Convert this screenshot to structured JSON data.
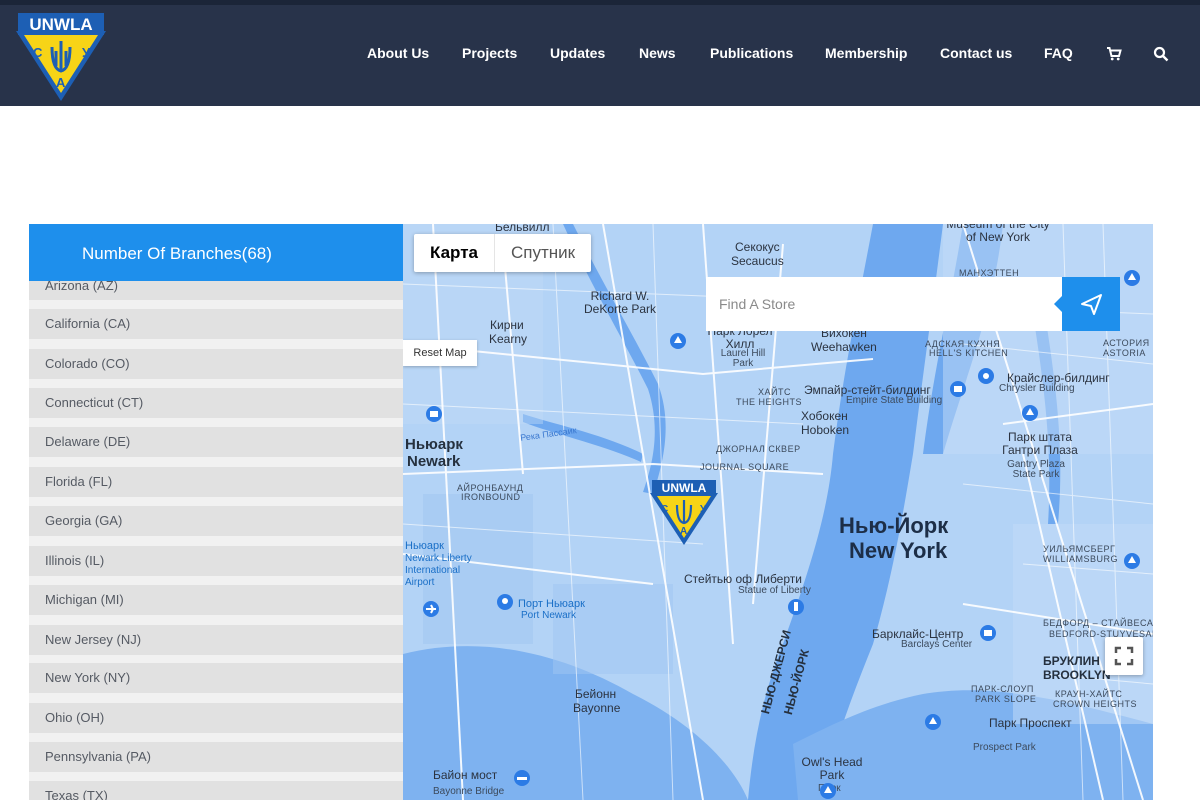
{
  "brand": {
    "logo_text": "UNWLA",
    "logo_letters": [
      "С",
      "У",
      "А"
    ],
    "colors": {
      "header_bg": "#28334a",
      "accent": "#1e8fec",
      "logo_blue": "#1d5fb4",
      "logo_yellow": "#f7d417"
    }
  },
  "nav": {
    "items": [
      "About Us",
      "Projects",
      "Updates",
      "News",
      "Publications",
      "Membership",
      "Contact us",
      "FAQ"
    ],
    "icons": [
      "cart-icon",
      "search-icon"
    ]
  },
  "sidebar": {
    "title": "Number Of Branches(68)",
    "states": [
      "Arizona (AZ)",
      "California (CA)",
      "Colorado (CO)",
      "Connecticut (CT)",
      "Delaware (DE)",
      "Florida (FL)",
      "Georgia (GA)",
      "Illinois (IL)",
      "Michigan (MI)",
      "New Jersey (NJ)",
      "New York (NY)",
      "Ohio (OH)",
      "Pennsylvania (PA)",
      "Texas (TX)"
    ]
  },
  "map": {
    "type_options": {
      "active": "Карта",
      "inactive": "Спутник"
    },
    "reset_label": "Reset Map",
    "search_placeholder": "Find A Store",
    "labels": {
      "ny_ru": "Нью-Йорк",
      "ny_en": "New York",
      "newark_ru": "Ньюарк",
      "newark_en": "Newark",
      "hoboken_ru": "Хобокен",
      "hoboken_en": "Hoboken",
      "secaucus_ru": "Секокус",
      "secaucus_en": "Secaucus",
      "kearny_ru": "Кирни",
      "kearny_en": "Kearny",
      "weehawken_ru": "Вихокен",
      "weehawken_en": "Weehawken",
      "bayonne_ru": "Бейонн",
      "bayonne_en": "Bayonne",
      "manhattan": "МАНХЭТТЕН",
      "heights": "ХАЙТС",
      "the_heights": "THE HEIGHTS",
      "journal_ru": "ДЖОРНАЛ СКВЕР",
      "journal_en": "JOURNAL SQUARE",
      "ironbound_ru": "АЙРОНБАУНД",
      "ironbound_en": "IRONBOUND",
      "hells_ru": "АДСКАЯ КУХНЯ",
      "hells_en": "HELL'S KITCHEN",
      "williamsburg_ru": "УИЛЬЯМСБЕРГ",
      "williamsburg_en": "WILLIAMSBURG",
      "brooklyn_ru": "БРУКЛИН",
      "brooklyn_en": "BROOKLYN",
      "empire_ru": "Эмпайр-стейт-билдинг",
      "empire_en": "Empire State Building",
      "chrysler_ru": "Крайслер-билдинг",
      "chrysler_en": "Chrysler Building",
      "liberty_ru": "Стейтью оф Либерти",
      "liberty_en": "Statue of Liberty",
      "barclays_ru": "Барклайс-Центр",
      "barclays_en": "Barclays Center",
      "port_ru": "Порт Ньюарк",
      "port_en": "Port Newark",
      "airport_ru": "Ньюарк",
      "airport_en": "Newark Liberty International Airport",
      "prospect_ru": "Парк Проспект",
      "prospect_en": "Prospect Park",
      "owls_ru": "Owl's Head Park",
      "owls_en": "Парк",
      "bridge_ru": "Байон мост",
      "bridge_en": "Bayonne Bridge",
      "gantry_ru": "Парк штата Гантри Плаза",
      "gantry_en": "Gantry Plaza State Park",
      "dekorte_ru": "Richard W. DeKorte Park",
      "laurel_ru": "Парк Лорел Хилл",
      "laurel_en": "Laurel Hill Park",
      "museum_ru": "Museum of the City of New York",
      "nj_river": "НЬЮ-ДЖЕРСИ",
      "ny_river": "НЬЮ-ЙОРК",
      "passaic": "Река Пассаик",
      "belleville": "Бельвилл",
      "bedford_ru": "БЕДФОРД – СТАЙВЕСАНТ",
      "bedford_en": "BEDFORD-STUYVESANT",
      "crown_ru": "КРАУН-ХАЙТС",
      "crown_en": "CROWN HEIGHTS",
      "parkslope_ru": "ПАРК-СЛОУП",
      "parkslope_en": "PARK SLOPE",
      "astoria_ru": "АСТОРИЯ",
      "astoria_en": "ASTORIA"
    }
  }
}
